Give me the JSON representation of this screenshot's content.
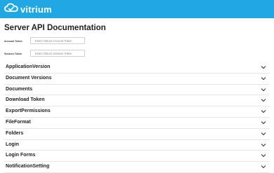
{
  "header": {
    "brand": "vitrium",
    "logo_icon": "cloud-icon"
  },
  "page": {
    "title": "Server API Documentation"
  },
  "tokens": {
    "account": {
      "label": "Account Token",
      "placeholder": "Enter Vitrium Account Token"
    },
    "session": {
      "label": "Session Token",
      "placeholder": "Enter Vitrium Session Token"
    }
  },
  "sections": [
    {
      "label": "ApplicationVersion"
    },
    {
      "label": "Document Versions"
    },
    {
      "label": "Documents"
    },
    {
      "label": "Download Token"
    },
    {
      "label": "ExportPermissions"
    },
    {
      "label": "FileFormat"
    },
    {
      "label": "Folders"
    },
    {
      "label": "Login"
    },
    {
      "label": "Login Forms"
    },
    {
      "label": "NotificationSetting"
    }
  ],
  "colors": {
    "header_bg": "#1fa8e1",
    "text": "#222222",
    "divider": "#e6e6e6"
  }
}
